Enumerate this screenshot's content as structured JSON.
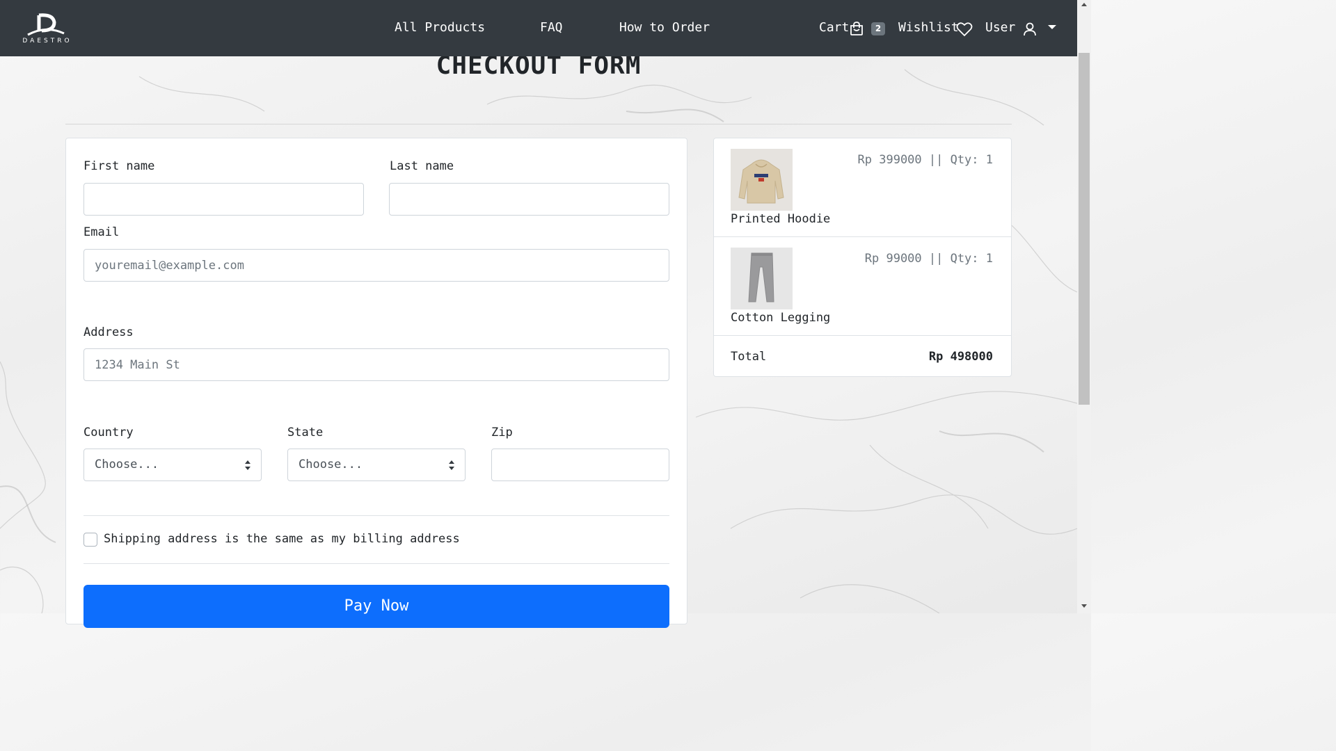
{
  "brand": {
    "logo_text": "DAESTRO"
  },
  "nav": {
    "links": [
      "All Products",
      "FAQ",
      "How to Order"
    ],
    "cart_label": "Cart",
    "cart_count": "2",
    "wishlist_label": "Wishlist",
    "user_label": "User"
  },
  "page": {
    "title": "CHECKOUT FORM"
  },
  "form": {
    "first_name_label": "First name",
    "last_name_label": "Last name",
    "email_label": "Email",
    "email_placeholder": "youremail@example.com",
    "address_label": "Address",
    "address_placeholder": "1234 Main St",
    "country_label": "Country",
    "country_value": "Choose...",
    "state_label": "State",
    "state_value": "Choose...",
    "zip_label": "Zip",
    "same_address_label": "Shipping address is the same as my billing address",
    "same_address_checked": false,
    "pay_button": "Pay Now"
  },
  "cart": {
    "items": [
      {
        "name": "Printed Hoodie",
        "price_line": "Rp 399000 || Qty: 1",
        "thumb_icon": "hoodie-image"
      },
      {
        "name": "Cotton Legging",
        "price_line": "Rp 99000 || Qty: 1",
        "thumb_icon": "legging-image"
      }
    ],
    "total_label": "Total",
    "total_value": "Rp 498000"
  },
  "colors": {
    "navbar": "#343a40",
    "primary": "#0d6efd",
    "muted": "#6c757d",
    "border": "#dee2e6"
  }
}
